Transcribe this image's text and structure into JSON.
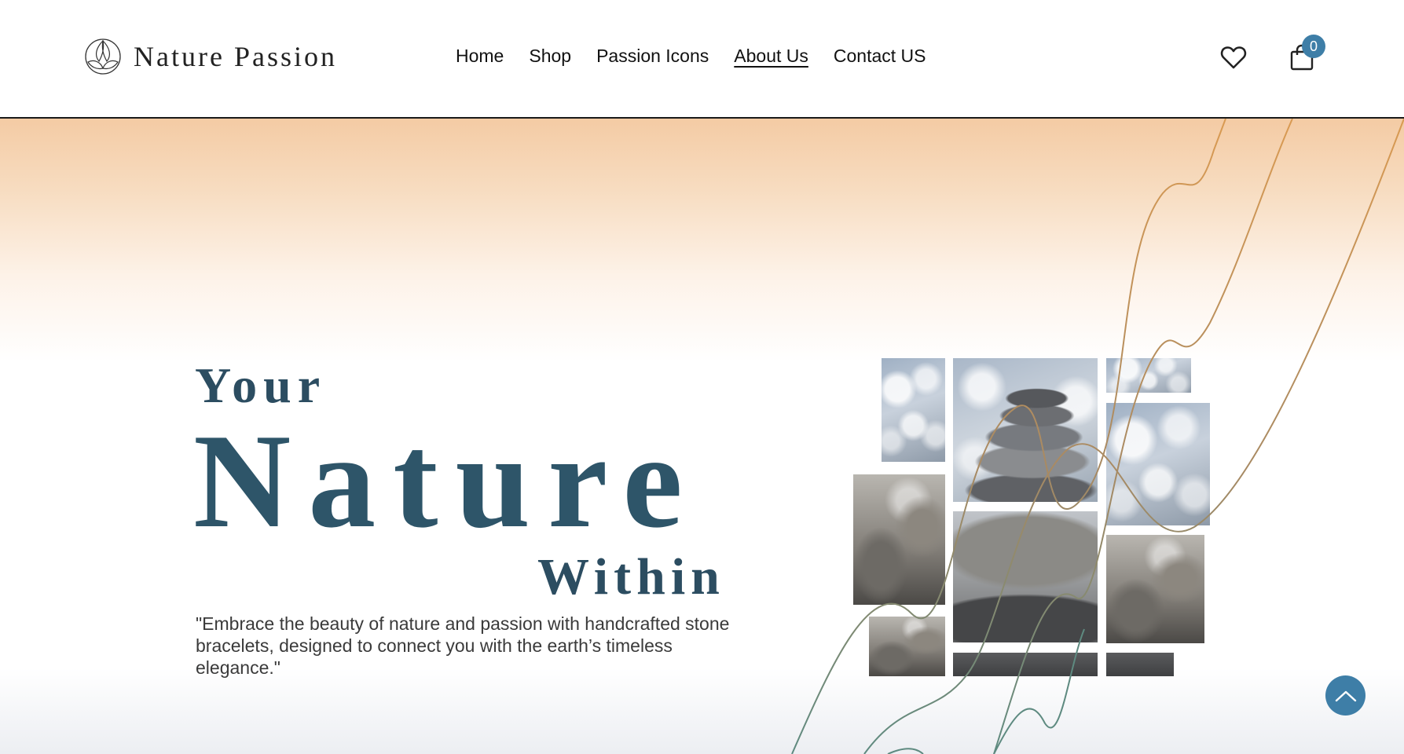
{
  "header": {
    "logo_text": "Nature Passion",
    "nav": [
      {
        "label": "Home"
      },
      {
        "label": "Shop"
      },
      {
        "label": "Passion Icons"
      },
      {
        "label": "About Us",
        "active": true
      },
      {
        "label": "Contact US"
      }
    ],
    "cart_count": "0",
    "icons": [
      "logo-icon",
      "heart-icon",
      "shopping-bag-icon"
    ]
  },
  "hero": {
    "headline_line1": "Your",
    "headline_line2": "Nature",
    "headline_line3": "Within",
    "tagline": "\"Embrace the beauty of nature and passion with handcrafted stone bracelets, designed to connect you with the earth’s timeless elegance.\""
  },
  "colors": {
    "accent": "#3e7ea7",
    "headline": "#2e5569",
    "gradient_top": "#f4cba4",
    "curve_orange": "#d99a52",
    "curve_teal": "#5e8a80"
  },
  "scroll_top": {
    "icon": "chevron-up-icon"
  }
}
